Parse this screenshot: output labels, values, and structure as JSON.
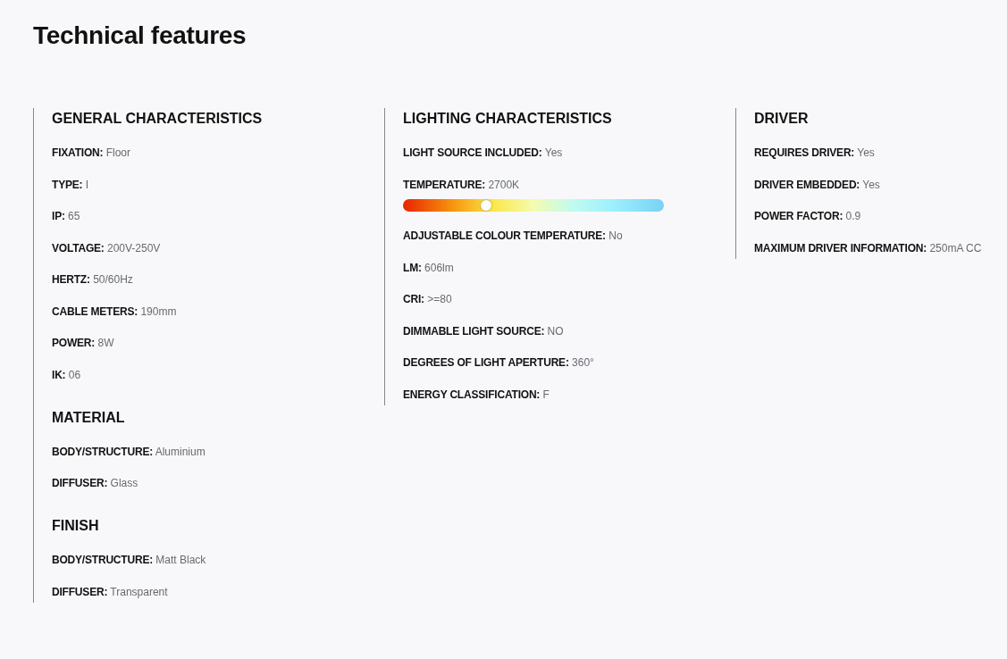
{
  "title": "Technical features",
  "columns": [
    {
      "groups": [
        {
          "title": "GENERAL CHARACTERISTICS",
          "rows": [
            {
              "kind": "text",
              "label": "FIXATION:",
              "value": "Floor"
            },
            {
              "kind": "text",
              "label": "TYPE:",
              "value": "I"
            },
            {
              "kind": "text",
              "label": "IP:",
              "value": "65"
            },
            {
              "kind": "text",
              "label": "VOLTAGE:",
              "value": "200V-250V"
            },
            {
              "kind": "text",
              "label": "HERTZ:",
              "value": "50/60Hz"
            },
            {
              "kind": "text",
              "label": "CABLE METERS:",
              "value": "190mm"
            },
            {
              "kind": "text",
              "label": "POWER:",
              "value": "8W"
            },
            {
              "kind": "text",
              "label": "IK:",
              "value": "06"
            }
          ]
        },
        {
          "title": "MATERIAL",
          "rows": [
            {
              "kind": "text",
              "label": "BODY/STRUCTURE:",
              "value": "Aluminium"
            },
            {
              "kind": "text",
              "label": "DIFFUSER:",
              "value": "Glass"
            }
          ]
        },
        {
          "title": "FINISH",
          "rows": [
            {
              "kind": "text",
              "label": "BODY/STRUCTURE:",
              "value": "Matt Black"
            },
            {
              "kind": "text",
              "label": "DIFFUSER:",
              "value": "Transparent"
            }
          ]
        }
      ]
    },
    {
      "groups": [
        {
          "title": "LIGHTING CHARACTERISTICS",
          "rows": [
            {
              "kind": "text",
              "label": "LIGHT SOURCE INCLUDED:",
              "value": "Yes"
            },
            {
              "kind": "slider",
              "label": "TEMPERATURE:",
              "value": "2700K",
              "level": 0.32
            },
            {
              "kind": "text",
              "label": "ADJUSTABLE COLOUR TEMPERATURE:",
              "value": "No"
            },
            {
              "kind": "text",
              "label": "LM:",
              "value": "606lm"
            },
            {
              "kind": "text",
              "label": "CRI:",
              "value": ">=80"
            },
            {
              "kind": "text",
              "label": "DIMMABLE LIGHT SOURCE:",
              "value": "NO"
            },
            {
              "kind": "text",
              "label": "DEGREES OF LIGHT APERTURE:",
              "value": "360°"
            },
            {
              "kind": "text",
              "label": "ENERGY CLASSIFICATION:",
              "value": "F"
            }
          ]
        }
      ]
    },
    {
      "groups": [
        {
          "title": "DRIVER",
          "rows": [
            {
              "kind": "text",
              "label": "REQUIRES DRIVER:",
              "value": "Yes"
            },
            {
              "kind": "text",
              "label": "DRIVER EMBEDDED:",
              "value": "Yes"
            },
            {
              "kind": "text",
              "label": "POWER FACTOR:",
              "value": "0.9"
            },
            {
              "kind": "text",
              "label": "MAXIMUM DRIVER INFORMATION:",
              "value": "250mA CC"
            }
          ]
        }
      ]
    }
  ]
}
